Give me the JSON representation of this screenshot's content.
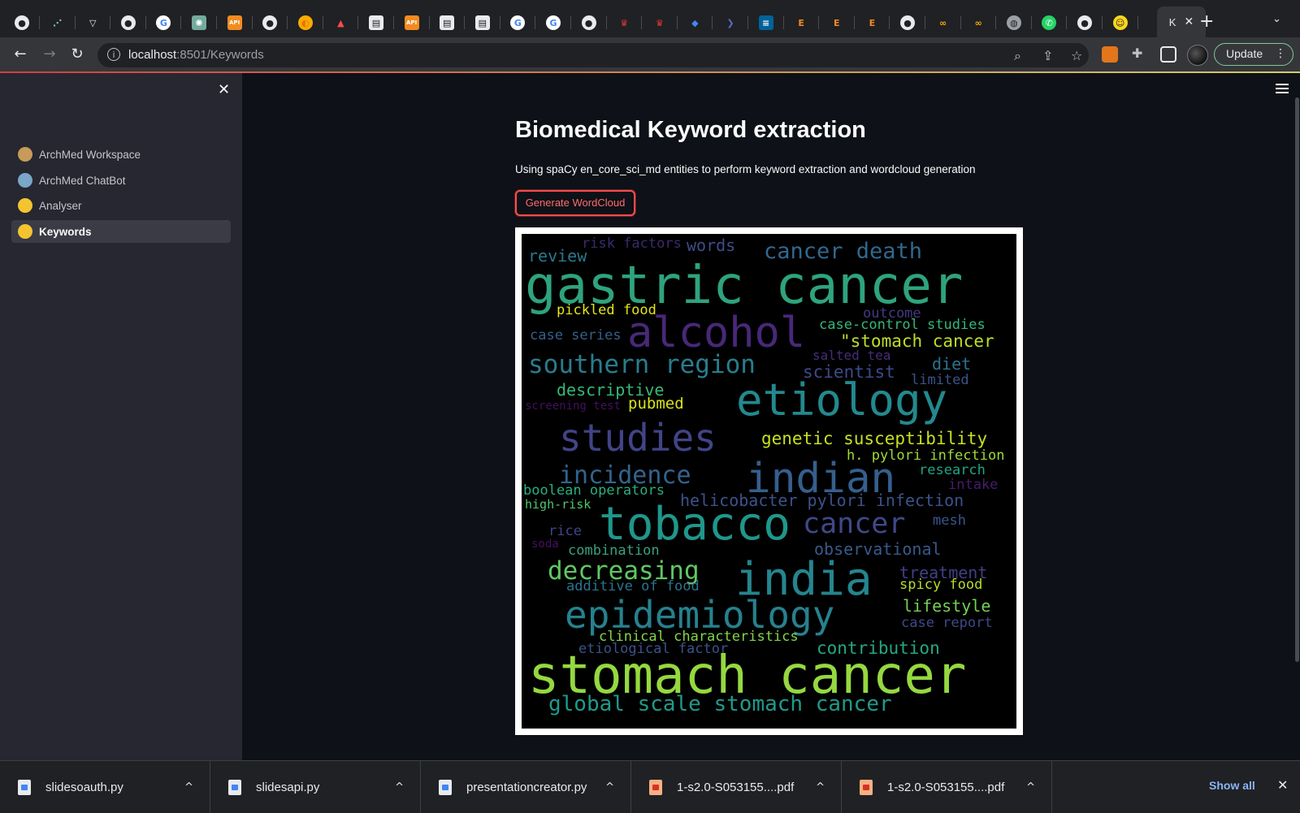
{
  "browser": {
    "tabs": [
      {
        "icon": "github-icon",
        "glyph": "●",
        "bg": "#e8eaed",
        "fg": "#202124",
        "shape": "circle"
      },
      {
        "icon": "graph-icon",
        "glyph": "⋰",
        "bg": "#202124",
        "fg": "#7fc8b8",
        "shape": "circle"
      },
      {
        "icon": "vercel-icon",
        "glyph": "▽",
        "bg": "#202124",
        "fg": "#e8eaed",
        "shape": "circle"
      },
      {
        "icon": "github-icon",
        "glyph": "●",
        "bg": "#e8eaed",
        "fg": "#202124",
        "shape": "circle"
      },
      {
        "icon": "google-icon",
        "glyph": "G",
        "bg": "#ffffff",
        "fg": "#4285f4",
        "shape": "circle"
      },
      {
        "icon": "openai-icon",
        "glyph": "✺",
        "bg": "#74aa9c",
        "fg": "#ffffff",
        "shape": "square"
      },
      {
        "icon": "api-icon",
        "glyph": "API",
        "bg": "#f28b20",
        "fg": "#ffffff",
        "shape": "square"
      },
      {
        "icon": "github-icon",
        "glyph": "●",
        "bg": "#e8eaed",
        "fg": "#202124",
        "shape": "circle"
      },
      {
        "icon": "colab-icon",
        "glyph": "◐",
        "bg": "#f9ab00",
        "fg": "#e8710a",
        "shape": "circle"
      },
      {
        "icon": "streamlit-icon",
        "glyph": "▲",
        "bg": "#202124",
        "fg": "#ff4b4b",
        "shape": "square"
      },
      {
        "icon": "notebook-icon",
        "glyph": "▤",
        "bg": "#e8eaed",
        "fg": "#202124",
        "shape": "square"
      },
      {
        "icon": "api-icon",
        "glyph": "API",
        "bg": "#f28b20",
        "fg": "#ffffff",
        "shape": "square"
      },
      {
        "icon": "notebook-icon",
        "glyph": "▤",
        "bg": "#e8eaed",
        "fg": "#202124",
        "shape": "square"
      },
      {
        "icon": "notebook-icon",
        "glyph": "▤",
        "bg": "#e8eaed",
        "fg": "#202124",
        "shape": "square"
      },
      {
        "icon": "google-icon",
        "glyph": "G",
        "bg": "#ffffff",
        "fg": "#4285f4",
        "shape": "circle"
      },
      {
        "icon": "google-icon",
        "glyph": "G",
        "bg": "#ffffff",
        "fg": "#4285f4",
        "shape": "circle"
      },
      {
        "icon": "github-icon",
        "glyph": "●",
        "bg": "#e8eaed",
        "fg": "#202124",
        "shape": "circle"
      },
      {
        "icon": "crown-icon",
        "glyph": "♛",
        "bg": "#202124",
        "fg": "#e53935",
        "shape": "square"
      },
      {
        "icon": "crown-icon",
        "glyph": "♛",
        "bg": "#202124",
        "fg": "#e53935",
        "shape": "square"
      },
      {
        "icon": "graduation-cap-icon",
        "glyph": "◆",
        "bg": "#202124",
        "fg": "#4285f4",
        "shape": "square"
      },
      {
        "icon": "arrow-icon",
        "glyph": "❯",
        "bg": "#202124",
        "fg": "#5c6bc0",
        "shape": "square"
      },
      {
        "icon": "ieee-icon",
        "glyph": "≡",
        "bg": "#00629b",
        "fg": "#ffffff",
        "shape": "square"
      },
      {
        "icon": "e-letter-icon",
        "glyph": "E",
        "bg": "#202124",
        "fg": "#f28b20",
        "shape": "square"
      },
      {
        "icon": "e-letter-icon",
        "glyph": "E",
        "bg": "#202124",
        "fg": "#f28b20",
        "shape": "square"
      },
      {
        "icon": "e-letter-icon",
        "glyph": "E",
        "bg": "#202124",
        "fg": "#f28b20",
        "shape": "square"
      },
      {
        "icon": "github-icon",
        "glyph": "●",
        "bg": "#e8eaed",
        "fg": "#202124",
        "shape": "circle"
      },
      {
        "icon": "infinity-icon",
        "glyph": "∞",
        "bg": "#202124",
        "fg": "#f9ab00",
        "shape": "square"
      },
      {
        "icon": "infinity-icon",
        "glyph": "∞",
        "bg": "#202124",
        "fg": "#f9ab00",
        "shape": "square"
      },
      {
        "icon": "globe-icon",
        "glyph": "◍",
        "bg": "#9aa0a6",
        "fg": "#202124",
        "shape": "circle"
      },
      {
        "icon": "whatsapp-icon",
        "glyph": "✆",
        "bg": "#25d366",
        "fg": "#ffffff",
        "shape": "circle"
      },
      {
        "icon": "github-icon",
        "glyph": "●",
        "bg": "#e8eaed",
        "fg": "#202124",
        "shape": "circle"
      },
      {
        "icon": "face-icon",
        "glyph": "☺",
        "bg": "#f9d71c",
        "fg": "#202124",
        "shape": "circle"
      }
    ],
    "active_tab_label": "K",
    "url_host": "localhost",
    "url_rest": ":8501/Keywords",
    "update_label": "Update"
  },
  "sidebar": {
    "items": [
      {
        "label": "ArchMed Workspace",
        "emoji": "🧑‍🏭",
        "color": "#c89b5a",
        "active": false
      },
      {
        "label": "ArchMed ChatBot",
        "emoji": "🤖",
        "color": "#7aa6c8",
        "active": false
      },
      {
        "label": "Analyser",
        "emoji": "🤔",
        "color": "#f4c430",
        "active": false
      },
      {
        "label": "Keywords",
        "emoji": "🤔",
        "color": "#f4c430",
        "active": true
      }
    ]
  },
  "main": {
    "title": "Biomedical Keyword extraction",
    "subtitle": "Using spaCy en_core_sci_md entities to perform keyword extraction and wordcloud generation",
    "button_label": "Generate WordCloud"
  },
  "wordcloud": {
    "words": [
      {
        "text": "risk factors",
        "color": "#3b2a6e"
      },
      {
        "text": "words",
        "color": "#3e4c8a"
      },
      {
        "text": "review",
        "color": "#2a788e"
      },
      {
        "text": "cancer death",
        "color": "#31688e"
      },
      {
        "text": "gastric cancer",
        "color": "#2ea37e"
      },
      {
        "text": "pickled food",
        "color": "#e5e419"
      },
      {
        "text": "outcome",
        "color": "#443983"
      },
      {
        "text": "alcohol",
        "color": "#482878"
      },
      {
        "text": "case-control studies",
        "color": "#35b779"
      },
      {
        "text": "case series",
        "color": "#34608d"
      },
      {
        "text": "\"stomach cancer",
        "color": "#bddf26"
      },
      {
        "text": "southern region",
        "color": "#287d8e"
      },
      {
        "text": "salted tea",
        "color": "#472d7b"
      },
      {
        "text": "diet",
        "color": "#2c728e"
      },
      {
        "text": "scientist",
        "color": "#3e4a89"
      },
      {
        "text": "limited",
        "color": "#3b528b"
      },
      {
        "text": "descriptive",
        "color": "#37b878"
      },
      {
        "text": "screening test",
        "color": "#440f5e"
      },
      {
        "text": "pubmed",
        "color": "#d8e219"
      },
      {
        "text": "etiology",
        "color": "#23898e"
      },
      {
        "text": "studies",
        "color": "#414487"
      },
      {
        "text": "genetic susceptibility",
        "color": "#c8e020"
      },
      {
        "text": "h. pylori infection",
        "color": "#9fda3a"
      },
      {
        "text": "incidence",
        "color": "#33638d"
      },
      {
        "text": "indian",
        "color": "#355f8d"
      },
      {
        "text": "research",
        "color": "#20a486"
      },
      {
        "text": "boolean operators",
        "color": "#29af7f"
      },
      {
        "text": "intake",
        "color": "#481c6e"
      },
      {
        "text": "high-risk",
        "color": "#52c569"
      },
      {
        "text": "helicobacter pylori infection",
        "color": "#3b528b"
      },
      {
        "text": "tobacco",
        "color": "#1f978b"
      },
      {
        "text": "cancer",
        "color": "#3f4889"
      },
      {
        "text": "mesh",
        "color": "#3a548c"
      },
      {
        "text": "rice",
        "color": "#414487"
      },
      {
        "text": "soda",
        "color": "#471063"
      },
      {
        "text": "combination",
        "color": "#3ba27b"
      },
      {
        "text": "observational",
        "color": "#38598c"
      },
      {
        "text": "decreasing",
        "color": "#5ec962"
      },
      {
        "text": "india",
        "color": "#25858e"
      },
      {
        "text": "treatment",
        "color": "#433e85"
      },
      {
        "text": "additive of food",
        "color": "#2c738e"
      },
      {
        "text": "spicy food",
        "color": "#b5de2b"
      },
      {
        "text": "epidemiology",
        "color": "#26818e"
      },
      {
        "text": "lifestyle",
        "color": "#73d056"
      },
      {
        "text": "case report",
        "color": "#3e4989"
      },
      {
        "text": "clinical characteristics",
        "color": "#84d44b"
      },
      {
        "text": "etiological factor",
        "color": "#3b528b"
      },
      {
        "text": "contribution",
        "color": "#26a784"
      },
      {
        "text": "stomach cancer",
        "color": "#95d840"
      },
      {
        "text": "global scale stomach cancer",
        "color": "#1f9a8a"
      }
    ]
  },
  "downloads": {
    "items": [
      {
        "name": "slidesoauth.py",
        "type": "py"
      },
      {
        "name": "slidesapi.py",
        "type": "py"
      },
      {
        "name": "presentationcreator.py",
        "type": "py"
      },
      {
        "name": "1-s2.0-S053155....pdf",
        "type": "pdf"
      },
      {
        "name": "1-s2.0-S053155....pdf",
        "type": "pdf"
      }
    ],
    "show_all_label": "Show all"
  }
}
